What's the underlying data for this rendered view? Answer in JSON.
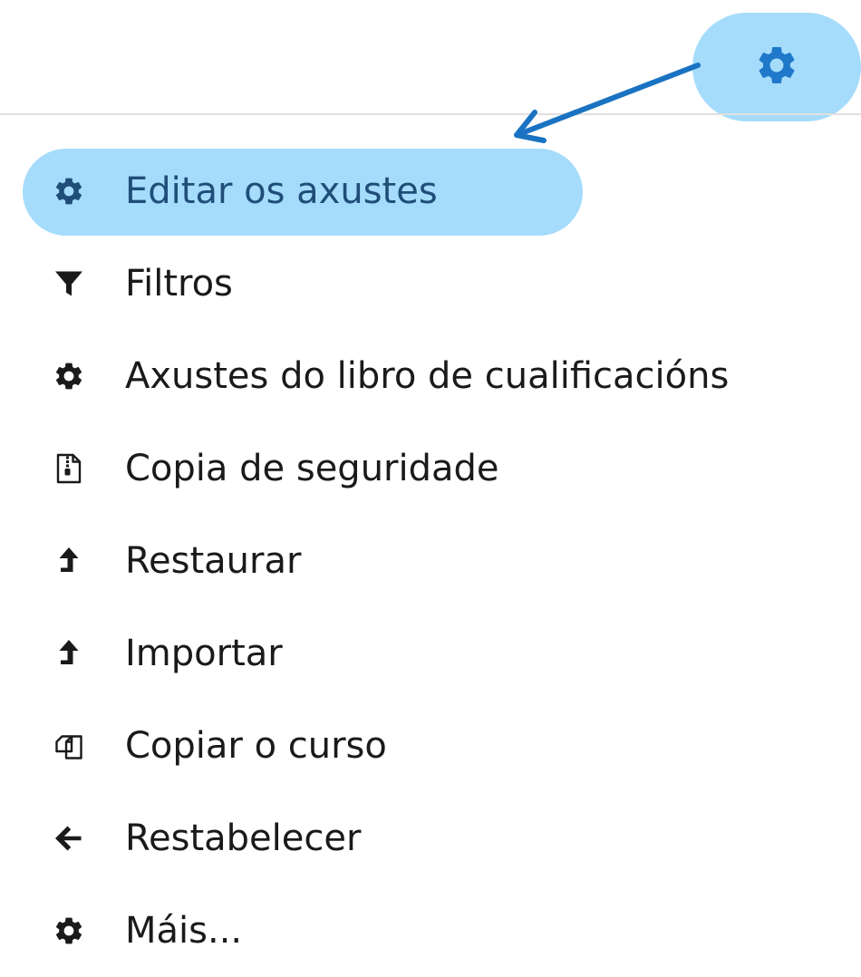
{
  "colors": {
    "highlight": "#a6dcfb",
    "accent": "#1f78c9",
    "annotation_arrow": "#1a73c2",
    "text": "#1a1a1a",
    "icon": "#1a1a1a",
    "divider": "#e0e0e0"
  },
  "header": {
    "settings_icon": "gear-icon"
  },
  "menu": {
    "items": [
      {
        "label": "Editar os axustes",
        "icon": "gear-icon",
        "highlighted": true
      },
      {
        "label": "Filtros",
        "icon": "filter-icon"
      },
      {
        "label": "Axustes do libro de cualificacións",
        "icon": "gear-icon"
      },
      {
        "label": "Copia de seguridade",
        "icon": "archive-file-icon"
      },
      {
        "label": "Restaurar",
        "icon": "level-up-icon"
      },
      {
        "label": "Importar",
        "icon": "level-up-icon"
      },
      {
        "label": "Copiar o curso",
        "icon": "copy-icon"
      },
      {
        "label": "Restabelecer",
        "icon": "arrow-left-icon"
      },
      {
        "label": "Máis...",
        "icon": "gear-icon"
      }
    ]
  }
}
